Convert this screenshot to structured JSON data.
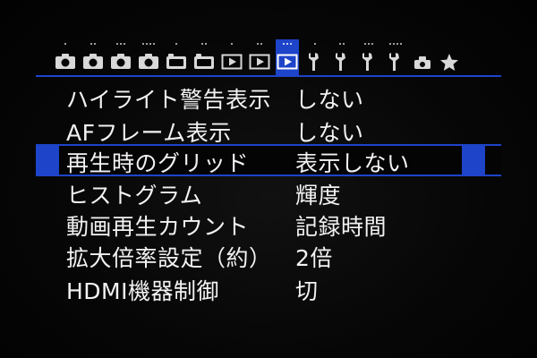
{
  "tabs": [
    {
      "icon": "camera-icon",
      "active": false
    },
    {
      "icon": "camera-icon",
      "active": false
    },
    {
      "icon": "camera-icon",
      "active": false
    },
    {
      "icon": "camera-icon",
      "active": false
    },
    {
      "icon": "camera-icon",
      "active": false
    },
    {
      "icon": "camera-icon",
      "active": false
    },
    {
      "icon": "playback-icon",
      "active": false
    },
    {
      "icon": "playback-icon",
      "active": false
    },
    {
      "icon": "playback-icon",
      "active": true
    },
    {
      "icon": "wrench-icon",
      "active": false
    },
    {
      "icon": "wrench-icon",
      "active": false
    },
    {
      "icon": "wrench-icon",
      "active": false
    },
    {
      "icon": "wrench-icon",
      "active": false
    },
    {
      "icon": "custom-function-icon",
      "active": false
    },
    {
      "icon": "star-icon",
      "active": false
    }
  ],
  "menu": {
    "items": [
      {
        "label": "ハイライト警告表示",
        "value": "しない"
      },
      {
        "label": "AFフレーム表示",
        "value": "しない"
      },
      {
        "label": "再生時のグリッド",
        "value": "表示しない"
      },
      {
        "label": "ヒストグラム",
        "value": "輝度"
      },
      {
        "label": "動画再生カウント",
        "value": "記録時間"
      },
      {
        "label": "拡大倍率設定（約）",
        "value": "2倍"
      },
      {
        "label": "HDMI機器制御",
        "value": "切"
      }
    ],
    "selected_index": 2
  },
  "colors": {
    "accent": "#1d44c9",
    "text": "#f2f2f2",
    "background": "#050505"
  }
}
